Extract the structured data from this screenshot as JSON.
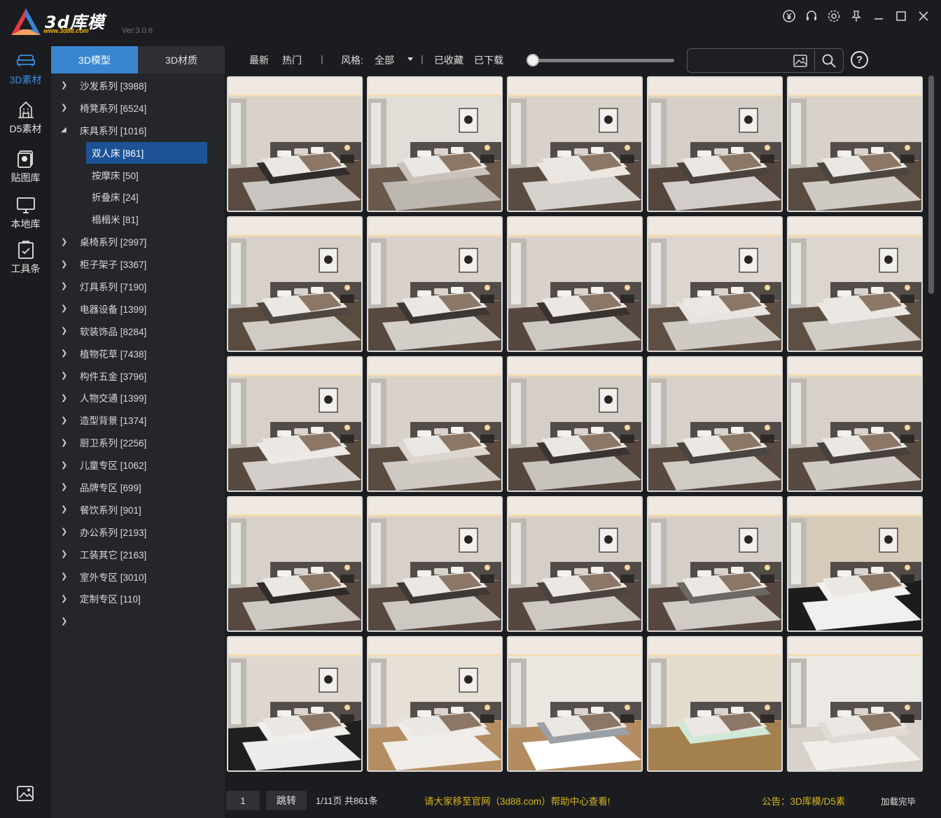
{
  "app": {
    "logo_text": "3d库模",
    "logo_url": "www.3d88.com",
    "version": "Ver:3.0.6",
    "window_icons": [
      "yen-icon",
      "headset-icon",
      "gear-icon",
      "pin-icon",
      "minimize-icon",
      "maximize-icon",
      "close-icon"
    ]
  },
  "rail": {
    "items": [
      {
        "label": "3D素材",
        "icon": "sofa-icon",
        "active": true
      },
      {
        "label": "D5素材",
        "icon": "building-icon",
        "active": false
      },
      {
        "label": "贴图库",
        "icon": "texture-icon",
        "active": false
      },
      {
        "label": "本地库",
        "icon": "monitor-icon",
        "active": false
      },
      {
        "label": "工具条",
        "icon": "toolbox-icon",
        "active": false
      }
    ],
    "bottom_icon": "image-edit-icon"
  },
  "tabs": [
    {
      "label": "3D模型",
      "active": true
    },
    {
      "label": "3D材质",
      "active": false
    }
  ],
  "categories": [
    {
      "label": "沙发系列 [3988]",
      "expanded": false
    },
    {
      "label": "椅凳系列 [6524]",
      "expanded": false
    },
    {
      "label": "床具系列 [1016]",
      "expanded": true,
      "children": [
        {
          "label": "双人床 [861]",
          "selected": true
        },
        {
          "label": "按摩床 [50]",
          "selected": false
        },
        {
          "label": "折叠床 [24]",
          "selected": false
        },
        {
          "label": "榻榻米 [81]",
          "selected": false
        }
      ]
    },
    {
      "label": "桌椅系列 [2997]",
      "expanded": false
    },
    {
      "label": "柜子架子 [3367]",
      "expanded": false
    },
    {
      "label": "灯具系列 [7190]",
      "expanded": false
    },
    {
      "label": "电器设备 [1399]",
      "expanded": false
    },
    {
      "label": "软装饰品 [8284]",
      "expanded": false
    },
    {
      "label": "植物花草 [7438]",
      "expanded": false
    },
    {
      "label": "构件五金 [3796]",
      "expanded": false
    },
    {
      "label": "人物交通 [1399]",
      "expanded": false
    },
    {
      "label": "造型背景 [1374]",
      "expanded": false
    },
    {
      "label": "厨卫系列 [2256]",
      "expanded": false
    },
    {
      "label": "儿童专区 [1062]",
      "expanded": false
    },
    {
      "label": "品牌专区 [699]",
      "expanded": false
    },
    {
      "label": "餐饮系列 [901]",
      "expanded": false
    },
    {
      "label": "办公系列 [2193]",
      "expanded": false
    },
    {
      "label": "工装其它 [2163]",
      "expanded": false
    },
    {
      "label": "室外专区 [3010]",
      "expanded": false
    },
    {
      "label": "定制专区 [110]",
      "expanded": false
    }
  ],
  "toolbar": {
    "latest": "最新",
    "hot": "热门",
    "sep": "|",
    "style_label": "风格:",
    "style_value": "全部",
    "favorites": "已收藏",
    "downloaded": "已下载",
    "search_value": "",
    "help_label": "?"
  },
  "thumbnails": [
    {
      "style": "dark-modern",
      "bed": "#2f2c2a",
      "wall": "#d8d2cb",
      "floor": "#5a4a3f",
      "rug": "#c9c4bf",
      "art": false
    },
    {
      "style": "gallery",
      "bed": "#c9c2ba",
      "wall": "#e2ddd7",
      "floor": "#6a5a4e",
      "rug": "#bdb7b1",
      "art": true
    },
    {
      "style": "modern",
      "bed": "#ebe6e0",
      "wall": "#d9d2ca",
      "floor": "#5b4c41",
      "rug": "#d6d2cd",
      "art": true
    },
    {
      "style": "modern",
      "bed": "#4a423d",
      "wall": "#d6cfc7",
      "floor": "#54463c",
      "rug": "#d2cdc8",
      "art": true
    },
    {
      "style": "modern",
      "bed": "#4c4540",
      "wall": "#d9d2ca",
      "floor": "#5a4b40",
      "rug": "#cfcac4",
      "art": false
    },
    {
      "style": "modern",
      "bed": "#4e4641",
      "wall": "#d8d1c9",
      "floor": "#5a4b40",
      "rug": "#d0cbc5",
      "art": true
    },
    {
      "style": "modern",
      "bed": "#3d3734",
      "wall": "#d9d2ca",
      "floor": "#574940",
      "rug": "#d3cec8",
      "art": true
    },
    {
      "style": "modern",
      "bed": "#38332f",
      "wall": "#d9d2ca",
      "floor": "#564840",
      "rug": "#cdc8c2",
      "art": false
    },
    {
      "style": "modern",
      "bed": "#e8e4df",
      "wall": "#ddd6ce",
      "floor": "#5e4f44",
      "rug": "#cfcac4",
      "art": true
    },
    {
      "style": "modern",
      "bed": "#ebe7e2",
      "wall": "#ddd6cf",
      "floor": "#5e4f44",
      "rug": "#d1ccc6",
      "art": true
    },
    {
      "style": "modern",
      "bed": "#ede9e4",
      "wall": "#d8d1c9",
      "floor": "#594a40",
      "rug": "#d3cec9",
      "art": true
    },
    {
      "style": "modern",
      "bed": "#dcd6cf",
      "wall": "#d9d2ca",
      "floor": "#5a4b40",
      "rug": "#cfcac4",
      "art": false
    },
    {
      "style": "modern",
      "bed": "#3a3532",
      "wall": "#d6cfc7",
      "floor": "#55473e",
      "rug": "#c8c3bd",
      "art": true
    },
    {
      "style": "modern",
      "bed": "#4a4440",
      "wall": "#d8d1c9",
      "floor": "#584a40",
      "rug": "#d0cbc5",
      "art": false
    },
    {
      "style": "modern",
      "bed": "#47403c",
      "wall": "#d8d1c9",
      "floor": "#584a40",
      "rug": "#cfcac4",
      "art": false
    },
    {
      "style": "modern",
      "bed": "#2e2b29",
      "wall": "#d8d1c9",
      "floor": "#574940",
      "rug": "#cdc8c2",
      "art": false
    },
    {
      "style": "modern",
      "bed": "#3f3935",
      "wall": "#d8d1c9",
      "floor": "#574940",
      "rug": "#cdc8c2",
      "art": true
    },
    {
      "style": "modern",
      "bed": "#4a433f",
      "wall": "#d6cfc7",
      "floor": "#564840",
      "rug": "#cdc8c2",
      "art": true
    },
    {
      "style": "modern",
      "bed": "#6e6864",
      "wall": "#d6cfc7",
      "floor": "#564840",
      "rug": "#d0cbc5",
      "art": true
    },
    {
      "style": "wood-frame",
      "bed": "#f2f1ee",
      "wall": "#d6cbb9",
      "floor": "#1c1c1c",
      "rug": "#f0f0f0",
      "art": true
    },
    {
      "style": "bright",
      "bed": "#f0efec",
      "wall": "#ddd7cf",
      "floor": "#1f1f1f",
      "rug": "#ececec",
      "art": true
    },
    {
      "style": "bright",
      "bed": "#efedea",
      "wall": "#e6e0d6",
      "floor": "#b58d62",
      "rug": "#f0ede8",
      "art": true
    },
    {
      "style": "bright",
      "bed": "#9aa0a6",
      "wall": "#ece8e1",
      "floor": "#b38c60",
      "rug": "#ffffff",
      "art": false
    },
    {
      "style": "bright",
      "bed": "#cfe9d6",
      "wall": "#e4dccd",
      "floor": "#a5804f",
      "rug": "#a5804f",
      "art": false
    },
    {
      "style": "bright",
      "bed": "#e0dbd4",
      "wall": "#ece9e4",
      "floor": "#d8d2ca",
      "rug": "#f2efea",
      "art": false
    }
  ],
  "footer": {
    "page_value": "1",
    "jump_label": "跳转",
    "page_info": "1/11页 共861条",
    "notice": "请大家移至官网（3d88.com）帮助中心查看!",
    "bulletin": "公告：3D库模/D5素",
    "load_status": "加载完毕"
  },
  "colors": {
    "accent": "#3a85d0",
    "selected": "#1d5296",
    "notice": "#d5b51c"
  }
}
